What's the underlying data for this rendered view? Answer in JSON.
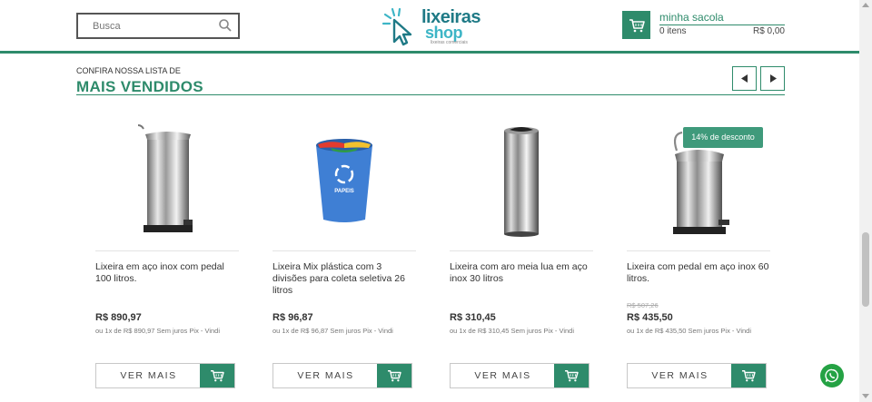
{
  "header": {
    "search_placeholder": "Busca",
    "logo": {
      "line1": "lixeiras",
      "line2": "shop",
      "tagline": "lixeiras comerciais"
    },
    "cart": {
      "title": "minha sacola",
      "items": "0 itens",
      "total": "R$ 0,00"
    }
  },
  "section": {
    "kicker": "CONFIRA NOSSA LISTA DE",
    "title": "MAIS VENDIDOS",
    "prev_icon": "arrow-left-icon",
    "next_icon": "arrow-right-icon"
  },
  "products": [
    {
      "name": "Lixeira em aço inox com pedal 100 litros.",
      "old_price": "",
      "price": "R$ 890,97",
      "installment": "ou 1x de R$ 890,97 Sem juros Pix - Vindi",
      "badge": "",
      "button_label": "VER MAIS"
    },
    {
      "name": "Lixeira Mix plástica com 3 divisões para coleta seletiva 26 litros",
      "old_price": "",
      "price": "R$ 96,87",
      "installment": "ou 1x de R$ 96,87 Sem juros Pix - Vindi",
      "badge": "",
      "button_label": "VER MAIS"
    },
    {
      "name": "Lixeira com aro meia lua em aço inox 30 litros",
      "old_price": "",
      "price": "R$ 310,45",
      "installment": "ou 1x de R$ 310,45 Sem juros Pix - Vindi",
      "badge": "",
      "button_label": "VER MAIS"
    },
    {
      "name": "Lixeira com pedal em aço inox 60 litros.",
      "old_price": "R$ 507,26",
      "price": "R$ 435,50",
      "installment": "ou 1x de R$ 435,50 Sem juros Pix - Vindi",
      "badge": "14% de desconto",
      "button_label": "VER MAIS"
    }
  ],
  "recycle_label": "PAPEIS",
  "colors": {
    "brand": "#2e8b6b",
    "whatsapp": "#25a244",
    "logo_dark": "#1f7a86",
    "logo_light": "#3db5c6"
  }
}
